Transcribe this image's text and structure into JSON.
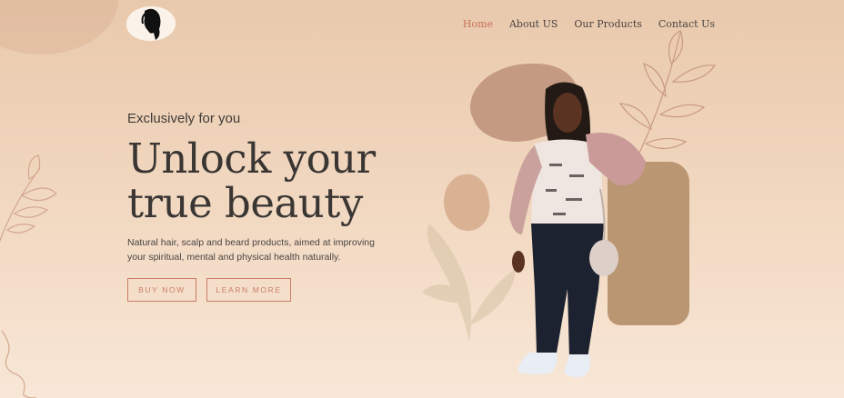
{
  "nav": {
    "items": [
      {
        "label": "Home",
        "active": true
      },
      {
        "label": "About US",
        "active": false
      },
      {
        "label": "Our Products",
        "active": false
      },
      {
        "label": "Contact Us",
        "active": false
      }
    ]
  },
  "hero": {
    "eyebrow": "Exclusively for you",
    "headline_line1": "Unlock your",
    "headline_line2": "true beauty",
    "description": "Natural hair, scalp and beard products, aimed at improving your spiritual, mental and physical health naturally.",
    "buy_label": "BUY NOW",
    "learn_label": "LEARN MORE"
  },
  "colors": {
    "accent": "#c97d66",
    "active_nav": "#c8705a",
    "background_top": "#e9c9ac",
    "background_bottom": "#f8e7d7"
  },
  "icons": {
    "logo": "woman-silhouette-logo",
    "leaf_decoration": "leaf-line-art"
  }
}
